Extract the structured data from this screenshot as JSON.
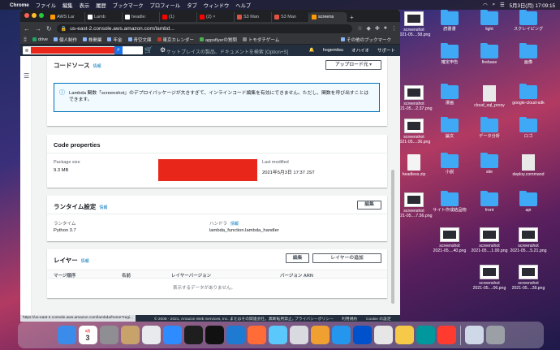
{
  "menubar": {
    "app": "Chrome",
    "items": [
      "ファイル",
      "編集",
      "表示",
      "履歴",
      "ブックマーク",
      "プロフィール",
      "タブ",
      "ウィンドウ",
      "ヘルプ"
    ],
    "datetime": "5月3日(月) 17:09:15"
  },
  "browser": {
    "tabs": [
      {
        "label": "AWS Lar"
      },
      {
        "label": "Lamb"
      },
      {
        "label": "headle:"
      },
      {
        "label": "(1)"
      },
      {
        "label": "(2) ×"
      },
      {
        "label": "S3 Man"
      },
      {
        "label": "S3 Man"
      },
      {
        "label": "screens",
        "active": true
      }
    ],
    "url": "us-east-2.console.aws.amazon.com/lambd...",
    "bookmarks": [
      {
        "label": "drive"
      },
      {
        "label": "個人制作"
      },
      {
        "label": "株開業"
      },
      {
        "label": "年金"
      },
      {
        "label": "青空文庫"
      },
      {
        "label": "東京カレンダー"
      },
      {
        "label": "appsflyerの質問"
      },
      {
        "label": "トモダチゲーム"
      }
    ],
    "bookmarks_other": "その他のブックマーク",
    "status_url": "https://us-east-2.console.aws.amazon.com/lambda/home?regi..."
  },
  "aws_nav": {
    "search_placeholder": "ケットプレイスの製品、ドキュメントを検索 [Option+S]",
    "user": "hogemitsu",
    "region": "オハイオ",
    "support": "サポート"
  },
  "code_source": {
    "title": "コードソース",
    "info": "情報",
    "upload_button": "アップロード元 ▾",
    "alert": "Lambda 関数「screenshot」のデプロイパッケージが大きすぎて、インラインコード編集を有効にできません。ただし、関数を呼び出すことはできます。"
  },
  "code_properties": {
    "title": "Code properties",
    "package_size_label": "Package size",
    "package_size": "9.3 MB",
    "last_modified_label": "Last modified",
    "last_modified": "2021年5月3日 17:37 JST"
  },
  "runtime": {
    "title": "ランタイム設定",
    "info": "情報",
    "edit_button": "編集",
    "runtime_label": "ランタイム",
    "runtime_value": "Python 3.7",
    "handler_label": "ハンドラ",
    "handler_info": "情報",
    "handler_value": "lambda_function.lambda_handler"
  },
  "layers": {
    "title": "レイヤー",
    "info": "情報",
    "edit_button": "編集",
    "add_button": "レイヤーの追加",
    "columns": [
      "マージ順序",
      "名前",
      "レイヤーバージョン",
      "バージョン ARN"
    ],
    "empty": "表示するデータがありません。"
  },
  "footer": {
    "copyright": "© 2008 - 2021, Amazon Web Services, Inc. またはその関連会社。無断転用禁止。",
    "privacy": "プライバシーポリシー",
    "terms": "利用規約",
    "cookie": "Cookie の設定"
  },
  "desktop": [
    {
      "label": "screenshot\n2021-05....58.png",
      "kind": "thumb"
    },
    {
      "label": "読書書",
      "kind": "folder"
    },
    {
      "label": "light",
      "kind": "folder"
    },
    {
      "label": "スクレイピング",
      "kind": "folder"
    },
    {
      "label": "",
      "kind": "folder"
    },
    {
      "label": "確定申告",
      "kind": "folder"
    },
    {
      "label": "firebase",
      "kind": "folder"
    },
    {
      "label": "画像",
      "kind": "folder"
    },
    {
      "label": "screenshot\n2021-05....2.37.png",
      "kind": "thumb"
    },
    {
      "label": "漫画",
      "kind": "folder"
    },
    {
      "label": "cloud_sql_proxy",
      "kind": "doc"
    },
    {
      "label": "google-cloud-sdk",
      "kind": "folder"
    },
    {
      "label": "screenshot\n2021-05....7.11.png",
      "kind": "thumb"
    },
    {
      "label": "",
      "kind": "folder"
    },
    {
      "label": "",
      "kind": "folder"
    },
    {
      "label": "",
      "kind": "folder"
    },
    {
      "label": "screenshot\n2021-05....36.png",
      "kind": "thumb"
    },
    {
      "label": "論文",
      "kind": "folder"
    },
    {
      "label": "データ分析",
      "kind": "folder"
    },
    {
      "label": "ロゴ",
      "kind": "folder"
    },
    {
      "label": "headless.zip",
      "kind": "fileic"
    },
    {
      "label": "小説",
      "kind": "folder"
    },
    {
      "label": "site",
      "kind": "folder"
    },
    {
      "label": "deploy.command",
      "kind": "doc"
    },
    {
      "label": "",
      "kind": "folder"
    },
    {
      "label": "",
      "kind": "folder"
    },
    {
      "label": "",
      "kind": "folder"
    },
    {
      "label": "",
      "kind": "folder"
    },
    {
      "label": "screenshot\n2021-05....7.56.png",
      "kind": "thumb"
    },
    {
      "label": "サイト作成結品物",
      "kind": "folder"
    },
    {
      "label": "front",
      "kind": "folder"
    },
    {
      "label": "api",
      "kind": "folder"
    },
    {
      "label": "screenshot\n2021-05....40.png",
      "kind": "thumb"
    },
    {
      "label": "screenshot\n2021-05....1.00.png",
      "kind": "thumb"
    },
    {
      "label": "screenshot\n2021-05....5.21.png",
      "kind": "thumb"
    },
    {
      "label": "screenshot\n2021-05....06.png",
      "kind": "thumb"
    },
    {
      "label": "screenshot\n2021-05....28.png",
      "kind": "thumb"
    }
  ],
  "dock": [
    {
      "icon": "finder-icon",
      "color": "#3b8bea"
    },
    {
      "icon": "calendar-icon",
      "color": "#ffffff",
      "text": "3",
      "month": "5月"
    },
    {
      "icon": "system-preferences-icon",
      "color": "#8e8e93"
    },
    {
      "icon": "contacts-icon",
      "color": "#c8a26b"
    },
    {
      "icon": "chrome-icon",
      "color": "#e8eaed"
    },
    {
      "icon": "zoom-icon",
      "color": "#2d8cff"
    },
    {
      "icon": "terminal-icon",
      "color": "#1e1e1e"
    },
    {
      "icon": "iterm-icon",
      "color": "#111111"
    },
    {
      "icon": "vscode-icon",
      "color": "#1f7ad1"
    },
    {
      "icon": "postman-icon",
      "color": "#ff6c37"
    },
    {
      "icon": "preview-icon",
      "color": "#5ac8fa"
    },
    {
      "icon": "sequel-pro-icon",
      "color": "#d9d9e0"
    },
    {
      "icon": "tableplus-icon",
      "color": "#f0a030"
    },
    {
      "icon": "docker-icon",
      "color": "#2496ed"
    },
    {
      "icon": "sourcetree-icon",
      "color": "#0052cc"
    },
    {
      "icon": "iphone-simulator-icon",
      "color": "#e6e6e6"
    },
    {
      "icon": "notes-icon",
      "color": "#f7c948"
    },
    {
      "icon": "arduino-icon",
      "color": "#00979d"
    },
    {
      "icon": "clock-icon",
      "color": "#ff3b30"
    },
    {
      "icon": "screenshot-folder-icon",
      "color": "#cfd8e6"
    },
    {
      "icon": "trash-icon",
      "color": "#9aa0a6"
    }
  ]
}
